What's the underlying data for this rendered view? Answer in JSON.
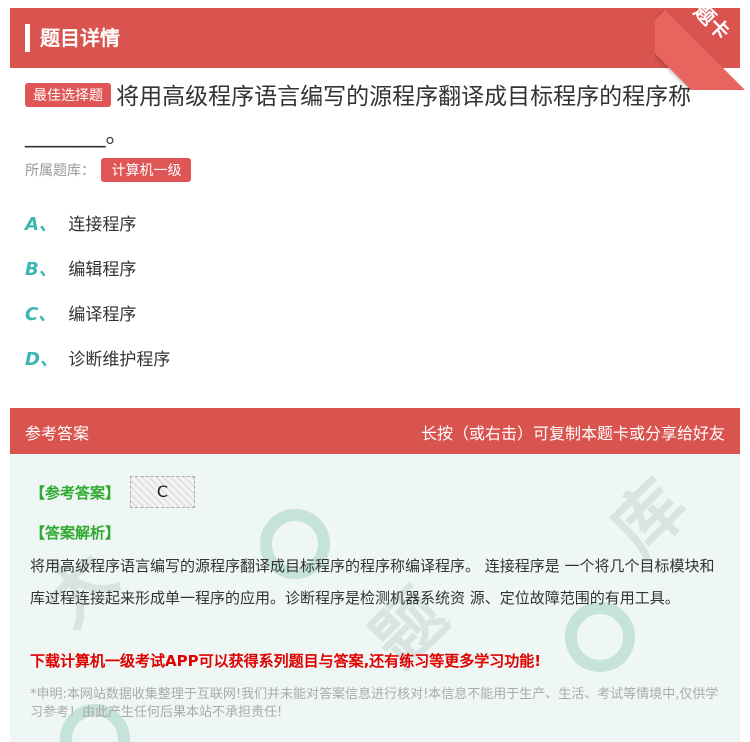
{
  "header": {
    "title": "题目详情",
    "corner_label": "题卡"
  },
  "question": {
    "badge": "最佳选择题",
    "text": "将用高级程序语言编写的源程序翻译成目标程序的程序称 _______。",
    "bank_label": "所属题库：",
    "bank_name": "计算机一级"
  },
  "options": [
    {
      "letter": "A、",
      "text": "连接程序"
    },
    {
      "letter": "B、",
      "text": "编辑程序"
    },
    {
      "letter": "C、",
      "text": "编译程序"
    },
    {
      "letter": "D、",
      "text": "诊断维护程序"
    }
  ],
  "answer_bar": {
    "left": "参考答案",
    "right": "长按（或右击）可复制本题卡或分享给好友"
  },
  "answer": {
    "label": "【参考答案】",
    "value": "C",
    "analysis_label": "【答案解析】",
    "analysis": "将用高级程序语言编写的源程序翻译成目标程序的程序称编译程序。 连接程序是 一个将几个目标模块和库过程连接起来形成单一程序的应用。诊断程序是检测机器系统资 源、定位故障范围的有用工具。",
    "promo": "下载计算机一级考试APP可以获得系列题目与答案,还有练习等更多学习功能!",
    "disclaimer": "*申明:本网站数据收集整理于互联网!我们并未能对答案信息进行核对!本信息不能用于生产、生活、考试等情境中,仅供学习参考！由此产生任何后果本站不承担责任!"
  },
  "colors": {
    "brand_red": "#d9534f",
    "option_letter": "#3bb7b0",
    "answer_green": "#2fa92f",
    "promo_red": "#e00000"
  }
}
